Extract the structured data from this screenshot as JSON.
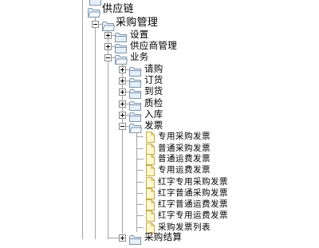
{
  "tree": {
    "root": {
      "label": "供应链"
    },
    "procurement": {
      "label": "采购管理"
    },
    "settings": {
      "label": "设置"
    },
    "supplier_management": {
      "label": "供应商管理"
    },
    "business": {
      "label": "业务"
    },
    "business_items": [
      {
        "label": "请购"
      },
      {
        "label": "订货"
      },
      {
        "label": "到货"
      },
      {
        "label": "质检"
      },
      {
        "label": "入库"
      }
    ],
    "invoice": {
      "label": "发票"
    },
    "invoice_items": [
      {
        "label": "专用采购发票"
      },
      {
        "label": "普通采购发票"
      },
      {
        "label": "普通运费发票"
      },
      {
        "label": "专用运费发票"
      },
      {
        "label": "红字专用采购发票"
      },
      {
        "label": "红字普通采购发票"
      },
      {
        "label": "红字普通运费发票"
      },
      {
        "label": "红字专用运费发票"
      },
      {
        "label": "采购发票列表"
      }
    ],
    "settlement": {
      "label": "采购结算"
    }
  },
  "icons": {
    "folder": "folder-icon",
    "document": "document-icon",
    "expand": "expand-icon",
    "collapse": "collapse-icon"
  },
  "colors": {
    "folder_light": "#e6eef7",
    "folder_dark": "#7e96ad",
    "document_fill": "#fff8cc",
    "document_border": "#c7a94a",
    "tree_line": "#a4a4a4",
    "toggle_border": "#8c8c8c"
  }
}
